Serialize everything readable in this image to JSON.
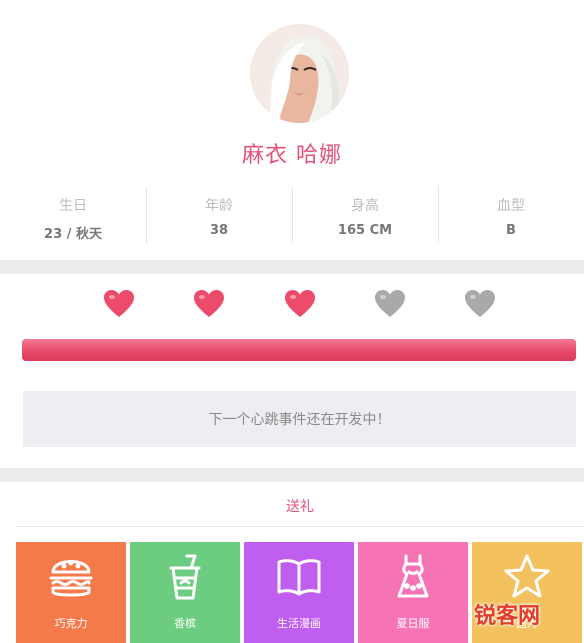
{
  "profile": {
    "name": "麻衣 哈娜",
    "stats": [
      {
        "label": "生日",
        "value": "23 / 秋天"
      },
      {
        "label": "年龄",
        "value": "38"
      },
      {
        "label": "身高",
        "value": "165 CM"
      },
      {
        "label": "血型",
        "value": "B"
      }
    ]
  },
  "affection": {
    "hearts_total": 5,
    "hearts_filled": 3,
    "progress": 1.0,
    "colors": {
      "filled": "#ec4b6c",
      "empty": "#a9a9a9",
      "bar": "#ea4a6a"
    }
  },
  "event": {
    "message": "下一个心跳事件还在开发中！"
  },
  "gifts": {
    "title": "送礼",
    "items": [
      {
        "label": "巧克力",
        "icon": "burger-icon",
        "color": "#f47a4c"
      },
      {
        "label": "香槟",
        "icon": "drink-cup-icon",
        "color": "#6ccd80"
      },
      {
        "label": "生活漫画",
        "icon": "book-icon",
        "color": "#c05ef0"
      },
      {
        "label": "夏日服",
        "icon": "dress-icon",
        "color": "#f674b6"
      },
      {
        "label": "画片",
        "icon": "star-icon",
        "color": "#f3c25e"
      }
    ]
  },
  "watermark": "锐客网"
}
